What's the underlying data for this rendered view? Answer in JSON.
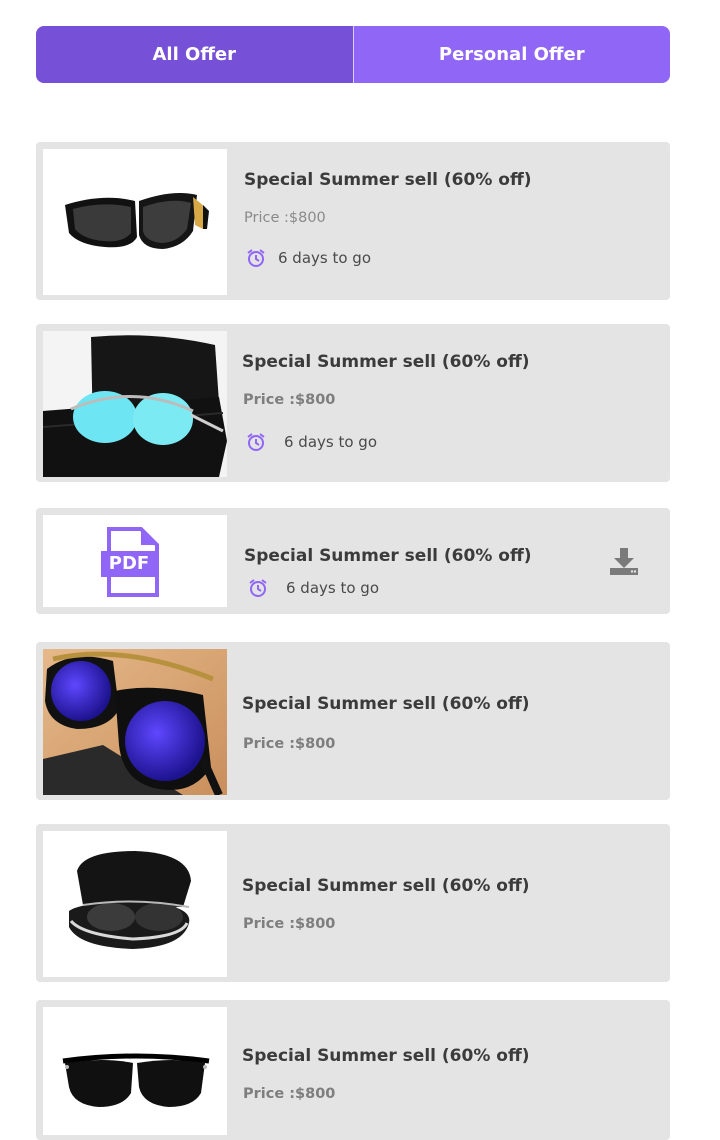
{
  "tabs": {
    "all_label": "All Offer",
    "personal_label": "Personal Offer"
  },
  "offers": [
    {
      "title": "Special Summer sell (60% off)",
      "price": "Price :$800",
      "countdown": "6 days to go",
      "image": "sunglasses-black-gold"
    },
    {
      "title": "Special Summer sell (60% off)",
      "price": "Price :$800",
      "countdown": "6 days to go",
      "image": "sunglasses-mirror-blue"
    },
    {
      "title": "Special Summer sell (60% off)",
      "countdown": "6 days to go",
      "image": "pdf-icon",
      "pdf_label": "PDF",
      "action_icon": "download-icon"
    },
    {
      "title": "Special Summer sell (60% off)",
      "price": "Price :$800",
      "image": "sunglasses-blue-lens"
    },
    {
      "title": "Special Summer sell (60% off)",
      "price": "Price :$800",
      "image": "aviator-in-case"
    },
    {
      "title": "Special Summer sell (60% off)",
      "price": "Price :$800",
      "image": "sunglasses-wayfarer-black"
    }
  ],
  "colors": {
    "accent": "#7650d6",
    "accent_light": "#8f66f6",
    "card_bg": "#e4e4e4",
    "clock": "#8f66f6"
  }
}
